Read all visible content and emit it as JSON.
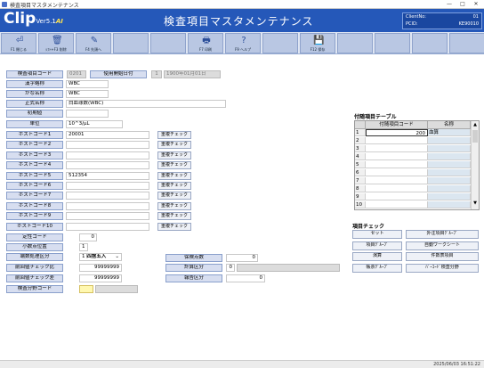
{
  "window": {
    "title": "検査項目マスタメンテナンス",
    "min": "—",
    "max": "□",
    "close": "✕"
  },
  "header": {
    "logo": "Clip",
    "version": "Ver5.1",
    "ai": "AI",
    "title": "検査項目マスタメンテナンス",
    "client_label": "ClientNo:",
    "client_value": "01",
    "pcid_label": "PCID:",
    "pcid_value": "KE90010"
  },
  "toolbar": [
    {
      "icon": "⏎",
      "label": "F1 閉じる"
    },
    {
      "icon": "🗑",
      "label": "ｼﾌﾄ+F3 削除"
    },
    {
      "icon": "✎",
      "label": "F4 先頭へ"
    },
    {
      "icon": "",
      "label": ""
    },
    {
      "icon": "",
      "label": ""
    },
    {
      "icon": "🖶",
      "label": "F7 印刷"
    },
    {
      "icon": "?",
      "label": "F9 ヘルプ"
    },
    {
      "icon": "",
      "label": ""
    },
    {
      "icon": "💾",
      "label": "F12 保存"
    },
    {
      "icon": "",
      "label": ""
    },
    {
      "icon": "",
      "label": ""
    },
    {
      "icon": "",
      "label": ""
    },
    {
      "icon": "",
      "label": ""
    }
  ],
  "form": {
    "code_label": "検査項目コード",
    "code_value": "0201",
    "start_date_label": "使用開始日付",
    "start_date_no": "1",
    "start_date_value": "1900年01月01日",
    "kanji_label": "漢字略称",
    "kanji_value": "WBC",
    "kana_label": "かな名称",
    "kana_value": "WBC",
    "formal_label": "正式名称",
    "formal_value": "白血球数(WBC)",
    "initial_label": "初期値",
    "initial_value": "",
    "unit_label": "単位",
    "unit_value": "10^3/μL",
    "host_codes": [
      {
        "label": "ホストコード1",
        "value": "20001",
        "check": "重複チェック"
      },
      {
        "label": "ホストコード2",
        "value": "",
        "check": "重複チェック"
      },
      {
        "label": "ホストコード3",
        "value": "",
        "check": "重複チェック"
      },
      {
        "label": "ホストコード4",
        "value": "",
        "check": "重複チェック"
      },
      {
        "label": "ホストコード5",
        "value": "512354",
        "check": "重複チェック"
      },
      {
        "label": "ホストコード6",
        "value": "",
        "check": "重複チェック"
      },
      {
        "label": "ホストコード7",
        "value": "",
        "check": "重複チェック"
      },
      {
        "label": "ホストコード8",
        "value": "",
        "check": "重複チェック"
      },
      {
        "label": "ホストコード9",
        "value": "",
        "check": "重複チェック"
      },
      {
        "label": "ホストコード10",
        "value": "",
        "check": "重複チェック"
      }
    ],
    "qual_label": "定性コード",
    "qual_value": "0",
    "decimal_label": "小数点位置",
    "decimal_value": "1",
    "rounding_label": "端数処理区分",
    "rounding_no": "1",
    "rounding_value": "四捨五入",
    "prev_check_label": "前回値チェック比",
    "prev_check_value": "99999999",
    "prev_diff_label": "前回値チェック差",
    "prev_diff_value": "99999999",
    "analysis_label": "検査分野コード",
    "analysis_value": "",
    "insurance_label": "保険点数",
    "insurance_value": "0",
    "calc_label": "計算区分",
    "calc_value": "0",
    "report_label": "報告区分",
    "report_value": "0"
  },
  "subtable": {
    "title": "付随項目テーブル",
    "col_code": "付随項目コード",
    "col_name": "名称",
    "rows": [
      {
        "no": "1",
        "code": "200",
        "name": "血算"
      },
      {
        "no": "2",
        "code": "",
        "name": ""
      },
      {
        "no": "3",
        "code": "",
        "name": ""
      },
      {
        "no": "4",
        "code": "",
        "name": ""
      },
      {
        "no": "5",
        "code": "",
        "name": ""
      },
      {
        "no": "6",
        "code": "",
        "name": ""
      },
      {
        "no": "7",
        "code": "",
        "name": ""
      },
      {
        "no": "8",
        "code": "",
        "name": ""
      },
      {
        "no": "9",
        "code": "",
        "name": ""
      },
      {
        "no": "10",
        "code": "",
        "name": ""
      }
    ]
  },
  "item_check": {
    "title": "項目チェック",
    "buttons": [
      "セット",
      "外注項目ｸﾞﾙｰﾌﾟ",
      "項目ｸﾞﾙｰﾌﾟ",
      "自動ワークシート",
      "演算",
      "件数表項目",
      "帳票ｸﾞﾙｰﾌﾟ",
      "ﾊﾞｰｺｰﾄﾞ検査分野"
    ]
  },
  "status": {
    "datetime": "2025/06/03  16:51:22"
  },
  "colors": {
    "header": "#2558b9",
    "accent": "#ffe24d",
    "label_bg": "#d7def0"
  }
}
